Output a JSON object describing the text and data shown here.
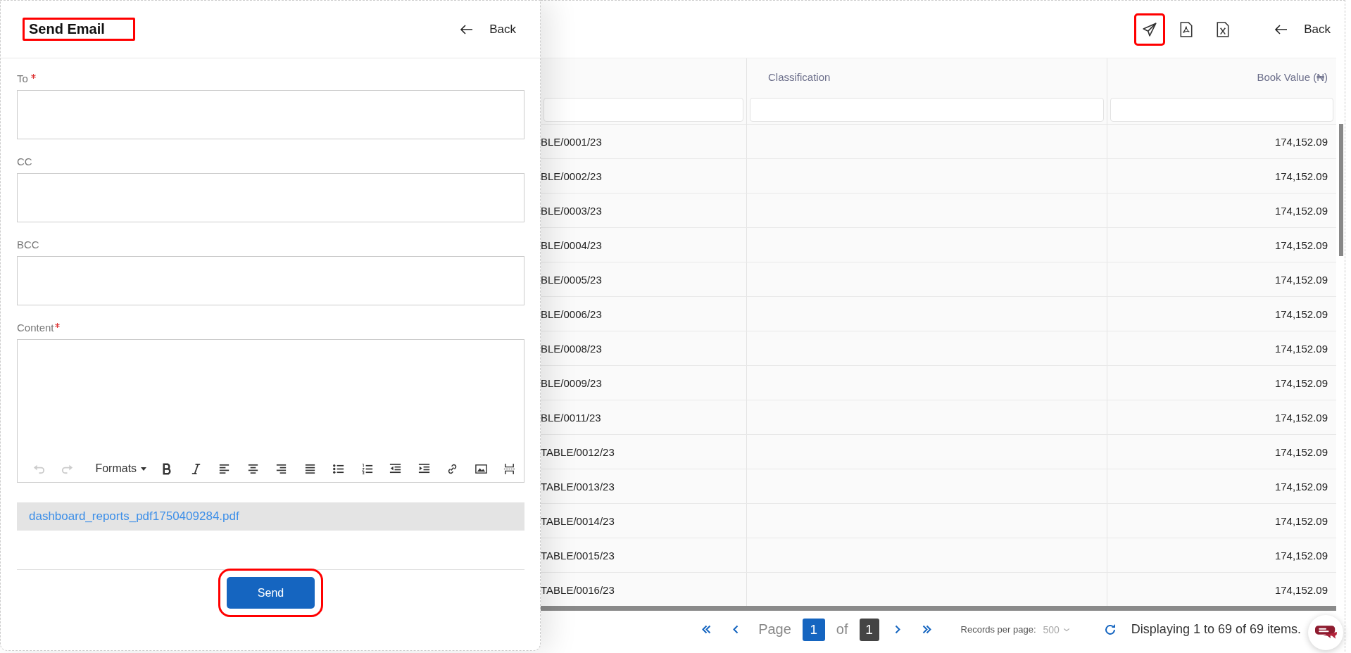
{
  "email_panel": {
    "title": "Send Email",
    "back": "Back",
    "fields": [
      {
        "label": "To",
        "required": true
      },
      {
        "label": "CC",
        "required": false
      },
      {
        "label": "BCC",
        "required": false
      }
    ],
    "content": {
      "label": "Content",
      "required": true,
      "toolbar": [
        {
          "kind": "undo",
          "disabled": true
        },
        {
          "kind": "redo",
          "disabled": true
        },
        {
          "kind": "dropdown",
          "label": "Formats",
          "disabled": false
        },
        {
          "kind": "bold",
          "disabled": false
        },
        {
          "kind": "italic",
          "disabled": false
        },
        {
          "kind": "align-left",
          "disabled": false
        },
        {
          "kind": "align-center",
          "disabled": false
        },
        {
          "kind": "align-right",
          "disabled": false
        },
        {
          "kind": "justify",
          "disabled": false
        },
        {
          "kind": "bullets",
          "disabled": false
        },
        {
          "kind": "numbers",
          "disabled": false
        },
        {
          "kind": "outdent",
          "disabled": false
        },
        {
          "kind": "indent",
          "disabled": false
        },
        {
          "kind": "link",
          "disabled": false
        },
        {
          "kind": "image",
          "disabled": false
        },
        {
          "kind": "page-break",
          "disabled": false
        }
      ]
    },
    "attachment": "dashboard_reports_pdf1750409284.pdf",
    "send": "Send"
  },
  "report": {
    "actions": [
      {
        "kind": "send",
        "highlighted": true
      },
      {
        "kind": "pdf",
        "highlighted": false
      },
      {
        "kind": "excel",
        "highlighted": false
      }
    ],
    "back": "Back",
    "table": {
      "columns": [
        "Classification",
        "Book Value (₦)"
      ],
      "rows": [
        {
          "column_1": "BLE/0001/23",
          "book_value": "174,152.09"
        },
        {
          "column_1": "BLE/0002/23",
          "book_value": "174,152.09"
        },
        {
          "column_1": "BLE/0003/23",
          "book_value": "174,152.09"
        },
        {
          "column_1": "BLE/0004/23",
          "book_value": "174,152.09"
        },
        {
          "column_1": "BLE/0005/23",
          "book_value": "174,152.09"
        },
        {
          "column_1": "BLE/0006/23",
          "book_value": "174,152.09"
        },
        {
          "column_1": "BLE/0008/23",
          "book_value": "174,152.09"
        },
        {
          "column_1": "BLE/0009/23",
          "book_value": "174,152.09"
        },
        {
          "column_1": "BLE/0011/23",
          "book_value": "174,152.09"
        },
        {
          "column_1": "TABLE/0012/23",
          "book_value": "174,152.09"
        },
        {
          "column_1": "TABLE/0013/23",
          "book_value": "174,152.09"
        },
        {
          "column_1": "TABLE/0014/23",
          "book_value": "174,152.09"
        },
        {
          "column_1": "TABLE/0015/23",
          "book_value": "174,152.09"
        },
        {
          "column_1": "TABLE/0016/23",
          "book_value": "174,152.09"
        }
      ]
    },
    "pagination": {
      "page_label": "Page",
      "page": "1",
      "of_label": "of",
      "total_pages": "1",
      "records_label": "Records per page:",
      "records_per_page": "500",
      "summary": "Displaying 1 to 69 of 69 items."
    }
  }
}
